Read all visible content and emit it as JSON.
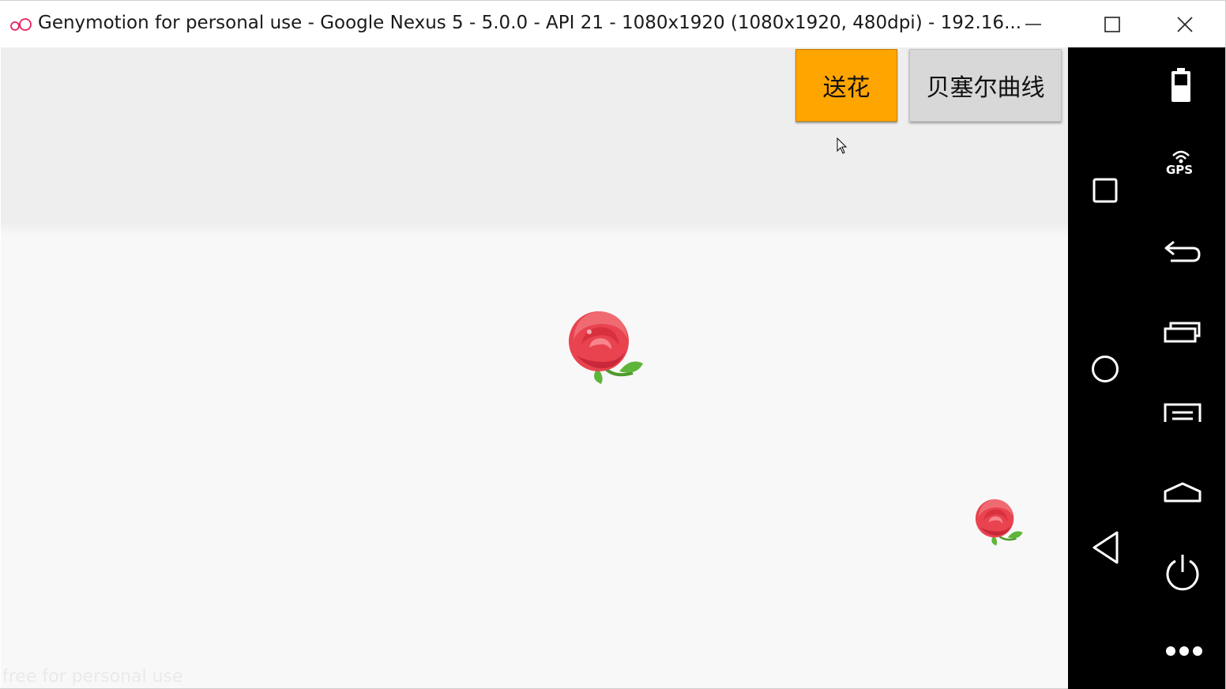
{
  "window": {
    "title": "Genymotion for personal use - Google Nexus 5 - 5.0.0 - API 21 - 1080x1920 (1080x1920, 480dpi) - 192.16...",
    "logo_icon": "genymotion-logo-icon",
    "minimize_icon": "minimize-icon",
    "maximize_icon": "maximize-icon",
    "close_icon": "close-icon"
  },
  "app": {
    "buttons": {
      "send_flower_label": "送花",
      "bezier_label": "贝塞尔曲线"
    },
    "colors": {
      "send_flower_bg": "#ffa500",
      "bezier_bg": "#d8d8d8",
      "actionbar_bg": "#eeeeee",
      "content_bg": "#f8f8f8"
    },
    "flowers": [
      {
        "icon": "rose-icon",
        "size": "large"
      },
      {
        "icon": "rose-icon",
        "size": "small"
      }
    ],
    "watermark": "free for personal use"
  },
  "nav_buttons": [
    {
      "icon": "recents-square-icon"
    },
    {
      "icon": "home-circle-icon"
    },
    {
      "icon": "back-triangle-icon"
    }
  ],
  "side_toolbar": [
    {
      "icon": "battery-icon"
    },
    {
      "icon": "gps-icon",
      "label": "GPS"
    },
    {
      "icon": "back-arrow-icon"
    },
    {
      "icon": "recent-apps-icon"
    },
    {
      "icon": "menu-icon"
    },
    {
      "icon": "home-icon"
    },
    {
      "icon": "power-icon"
    },
    {
      "icon": "more-dots-icon"
    }
  ]
}
